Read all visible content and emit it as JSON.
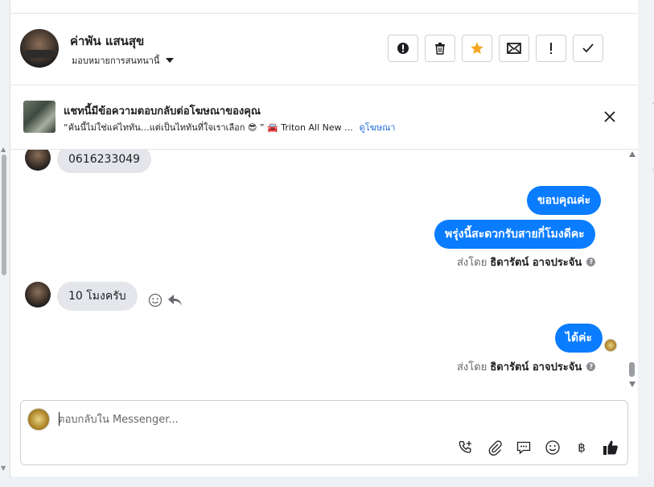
{
  "header": {
    "contact_name": "ค่าพัน แสนสุข",
    "assign_label": "มอบหมายการสนทนานี้",
    "actions": [
      {
        "name": "alert-icon",
        "label": "spam"
      },
      {
        "name": "trash-icon",
        "label": "delete"
      },
      {
        "name": "star-icon",
        "label": "follow up"
      },
      {
        "name": "envelope-icon",
        "label": "unread"
      },
      {
        "name": "exclamation-icon",
        "label": "important"
      },
      {
        "name": "check-icon",
        "label": "done"
      }
    ]
  },
  "ad_banner": {
    "title": "แชทนี้มีข้อความตอบกลับต่อโฆษณาของคุณ",
    "snippet": "“คันนี้ไม่ใช่แค่ไททัน…แต่เป็นไททันที่ใจเราเลือก 😎 ” 🚘 Triton All New ...",
    "link_label": "ดูโฆษณา"
  },
  "messages": {
    "incoming_phone": "0616233049",
    "outgoing_thanks": "ขอบคุณค่ะ",
    "outgoing_question": "พรุ่งนี้สะดวกรับสายกี่โมงดีคะ",
    "sent_by_1_prefix": "ส่งโดย",
    "sent_by_1_name": "ธิดารัตน์ อาจประจัน",
    "incoming_time": "10 โมงครับ",
    "outgoing_ok": "ได้ค่ะ",
    "sent_by_2_prefix": "ส่งโดย",
    "sent_by_2_name": "ธิดารัตน์ อาจประจัน"
  },
  "composer": {
    "placeholder": "ตอบกลับใน Messenger...",
    "tools": [
      "call-icon",
      "attach-icon",
      "saved-reply-icon",
      "emoji-icon",
      "baht-icon",
      "like-icon"
    ],
    "baht_symbol": "฿"
  },
  "colors": {
    "accent": "#0a7cff",
    "star": "#f5a623",
    "incoming_bg": "#e4e6eb"
  }
}
